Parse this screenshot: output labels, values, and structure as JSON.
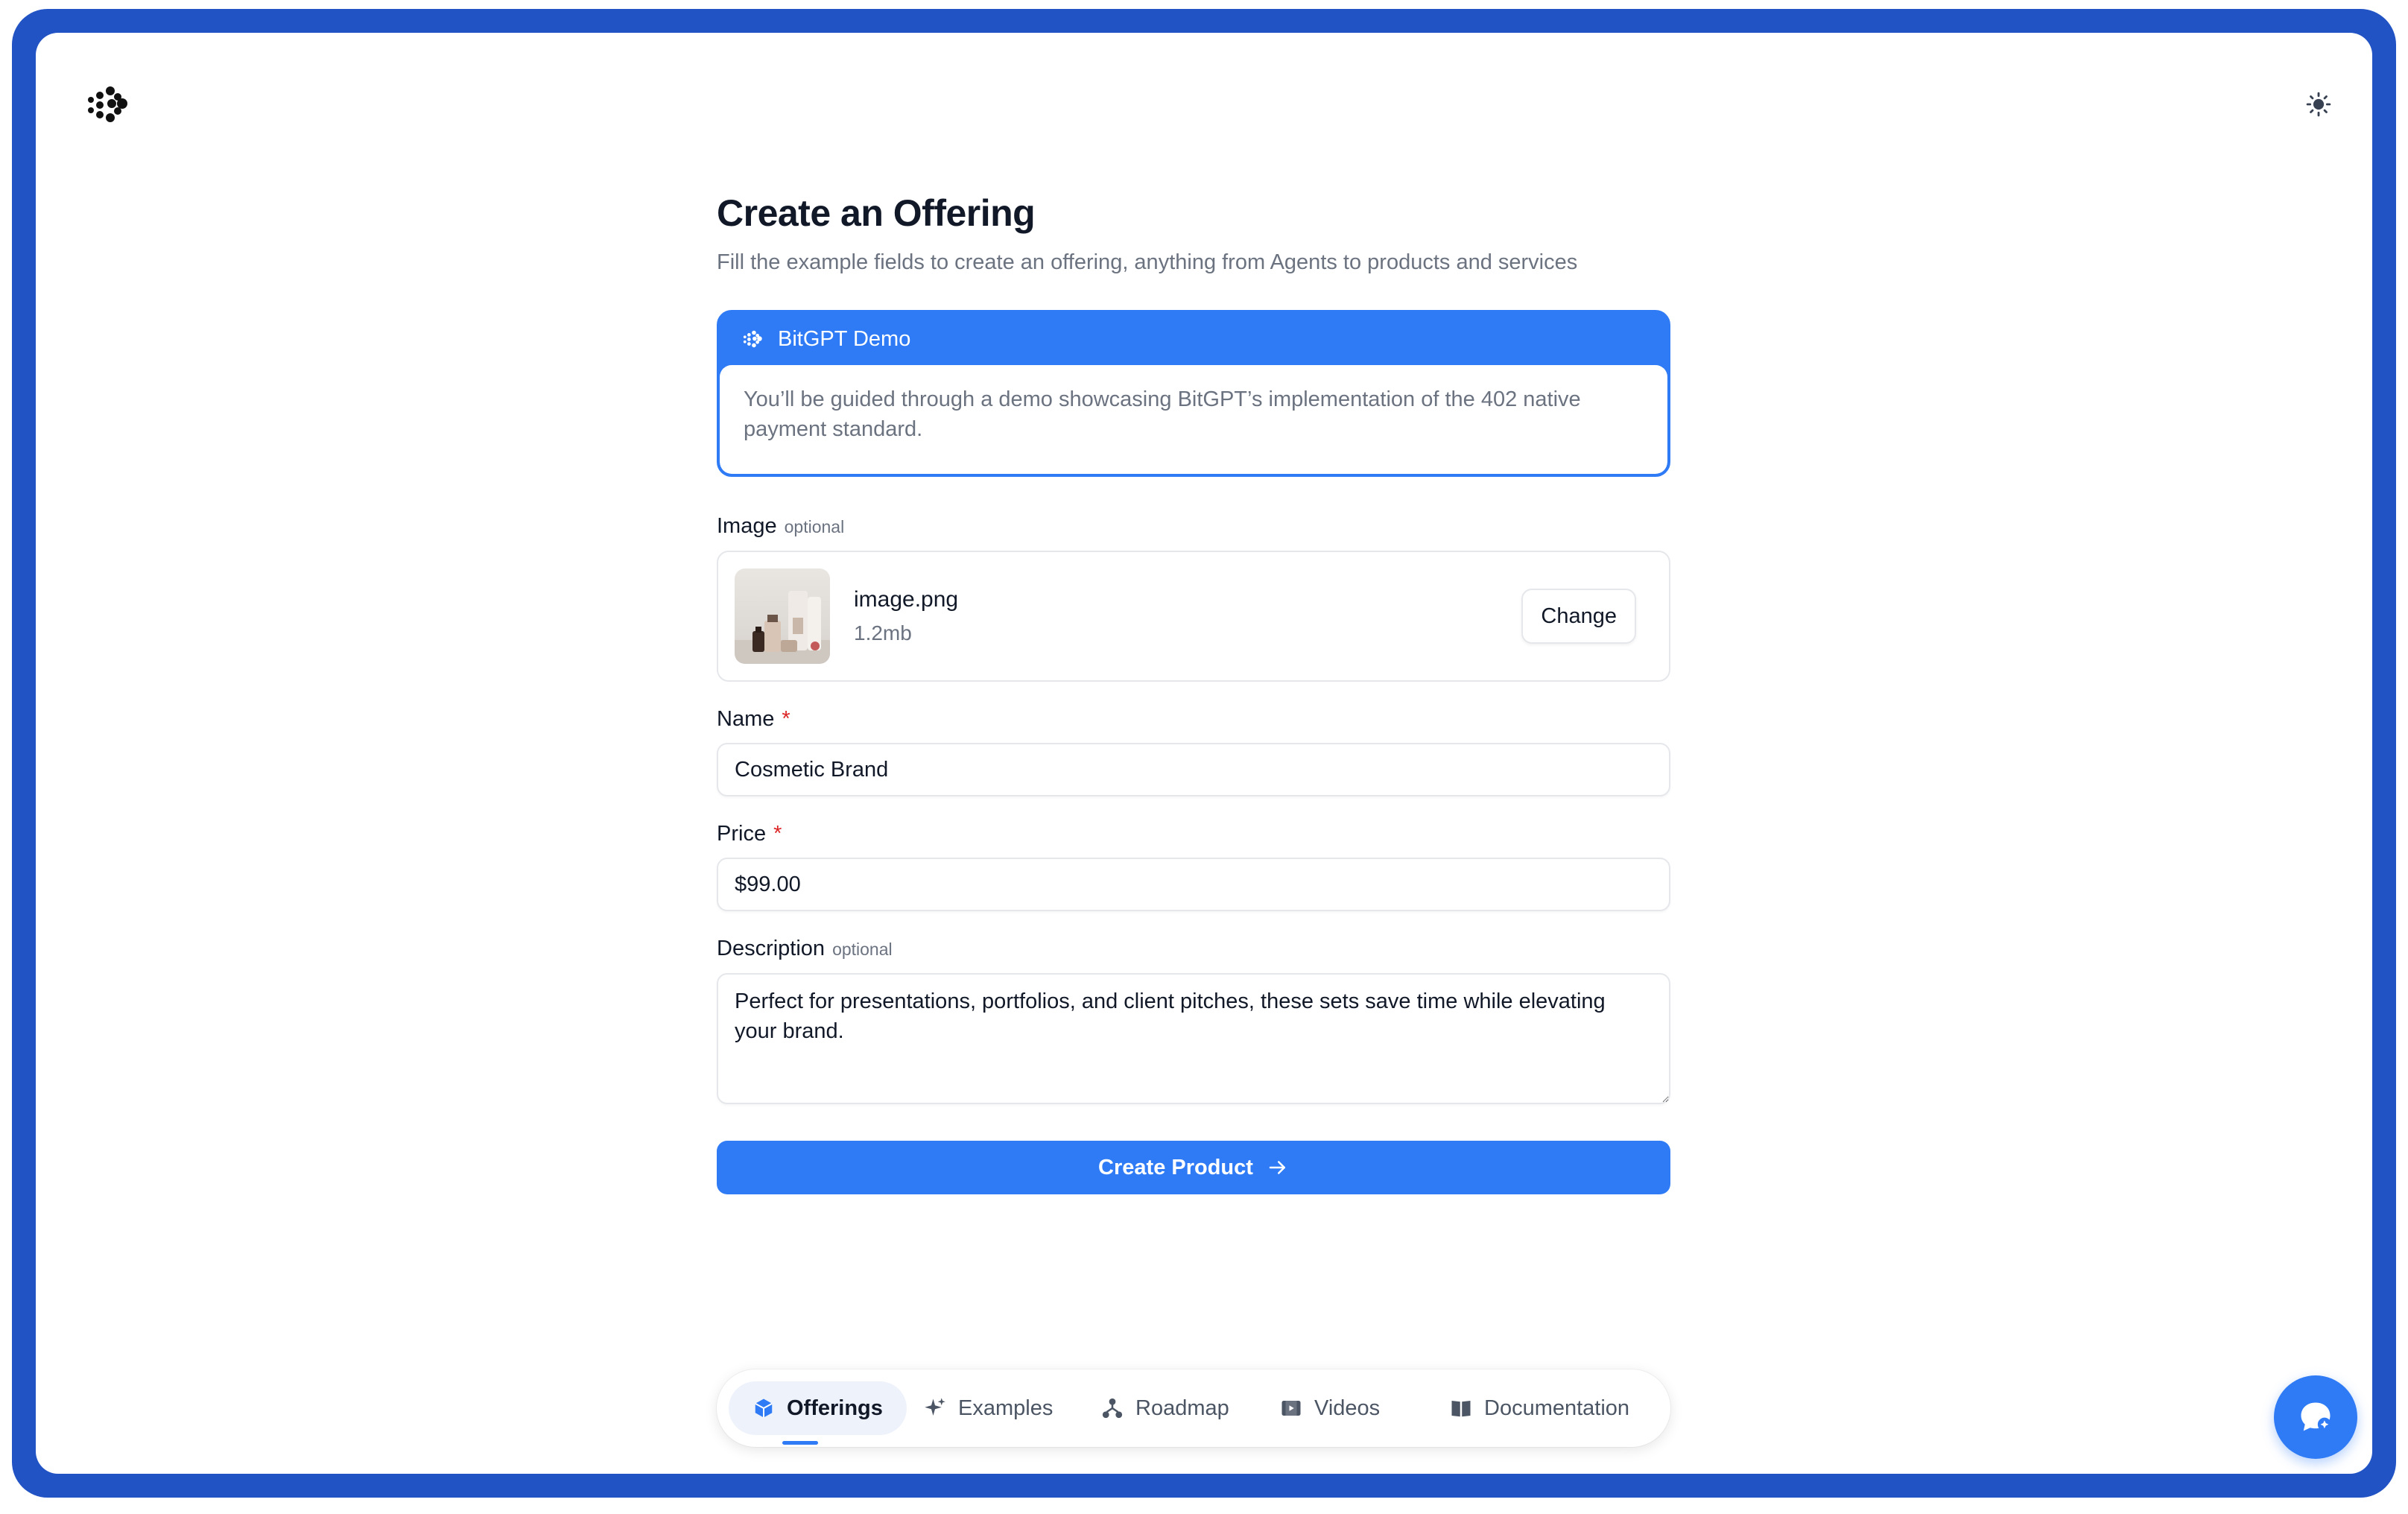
{
  "header": {
    "logo_icon": "bitgpt-logo-icon",
    "theme_toggle_icon": "sun-icon"
  },
  "page": {
    "title": "Create an Offering",
    "subtitle": "Fill the example fields to create an offering, anything from Agents to products and services"
  },
  "demo_card": {
    "title": "BitGPT Demo",
    "icon": "bitgpt-logo-icon",
    "body": "You’ll be guided through a demo showcasing BitGPT’s implementation of the 402 native payment standard."
  },
  "form": {
    "image": {
      "label": "Image",
      "hint": "optional",
      "file_name": "image.png",
      "file_size": "1.2mb",
      "change_label": "Change"
    },
    "name": {
      "label": "Name",
      "required_mark": "*",
      "value": "Cosmetic Brand"
    },
    "price": {
      "label": "Price",
      "required_mark": "*",
      "value": "$99.00"
    },
    "description": {
      "label": "Description",
      "hint": "optional",
      "value": "Perfect for presentations, portfolios, and client pitches, these sets save time while elevating your brand."
    },
    "submit_label": "Create Product",
    "submit_icon": "arrow-right-icon"
  },
  "bottom_nav": {
    "items": [
      {
        "label": "Offerings",
        "icon": "cube-icon",
        "active": true
      },
      {
        "label": "Examples",
        "icon": "sparkle-icon",
        "active": false
      },
      {
        "label": "Roadmap",
        "icon": "nodes-icon",
        "active": false
      },
      {
        "label": "Videos",
        "icon": "video-icon",
        "active": false
      },
      {
        "label": "Documentation",
        "icon": "book-icon",
        "active": false
      }
    ]
  },
  "chat_fab_icon": "chat-bubble-icon",
  "colors": {
    "frame": "#2153c4",
    "accent": "#2f7bf6",
    "required": "#dc2626",
    "muted_text": "#6b7280",
    "border": "#e5e7eb"
  }
}
